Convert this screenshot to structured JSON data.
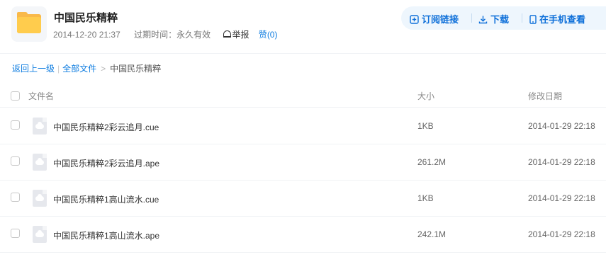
{
  "share": {
    "title": "中国民乐精粹",
    "date": "2014-12-20 21:37",
    "expire": "过期时间：永久有效",
    "report": "举报",
    "like": "赞(0)"
  },
  "actions": {
    "subscribe": "订阅链接",
    "download": "下载",
    "mobile": "在手机查看"
  },
  "breadcrumb": {
    "back": "返回上一级",
    "all": "全部文件",
    "separator": "|",
    "arrow": ">",
    "current": "中国民乐精粹"
  },
  "table": {
    "columns": {
      "name": "文件名",
      "size": "大小",
      "modified": "修改日期"
    },
    "rows": [
      {
        "name": "中国民乐精粹2彩云追月.cue",
        "size": "1KB",
        "modified": "2014-01-29 22:18"
      },
      {
        "name": "中国民乐精粹2彩云追月.ape",
        "size": "261.2M",
        "modified": "2014-01-29 22:18"
      },
      {
        "name": "中国民乐精粹1高山流水.cue",
        "size": "1KB",
        "modified": "2014-01-29 22:18"
      },
      {
        "name": "中国民乐精粹1高山流水.ape",
        "size": "242.1M",
        "modified": "2014-01-29 22:18"
      }
    ]
  },
  "colors": {
    "accent": "#0f7de0",
    "folder": "#ffcc4d",
    "action_bg": "#eef6fd"
  }
}
